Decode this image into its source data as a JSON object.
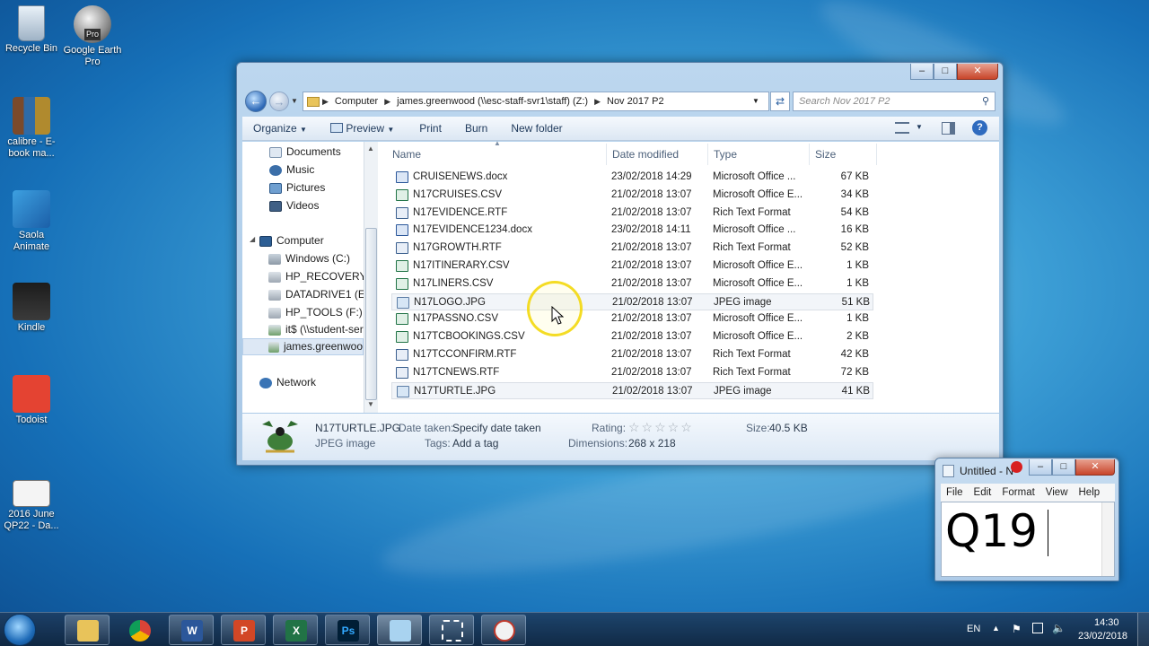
{
  "desktop": {
    "icons": [
      {
        "label": "Recycle Bin"
      },
      {
        "label": "Google Earth Pro",
        "badge": "Pro"
      },
      {
        "label": "calibre - E-book ma..."
      },
      {
        "label": "Saola Animate"
      },
      {
        "label": "Kindle"
      },
      {
        "label": "Todoist"
      },
      {
        "label": "2016 June QP22 - Da..."
      }
    ]
  },
  "explorer": {
    "address": {
      "segments": [
        "Computer",
        "james.greenwood (\\\\esc-staff-svr1\\staff) (Z:)",
        "Nov 2017 P2"
      ]
    },
    "search_placeholder": "Search Nov 2017 P2",
    "toolbar": {
      "organize": "Organize",
      "preview": "Preview",
      "print": "Print",
      "burn": "Burn",
      "new_folder": "New folder"
    },
    "nav": {
      "libraries": [
        "Documents",
        "Music",
        "Pictures",
        "Videos"
      ],
      "computer": "Computer",
      "drives": [
        "Windows (C:)",
        "HP_RECOVERY (D:",
        "DATADRIVE1 (E:)",
        "HP_TOOLS (F:)",
        "it$ (\\\\student-ser",
        "james.greenwoo"
      ],
      "network": "Network"
    },
    "columns": {
      "name": "Name",
      "date": "Date modified",
      "type": "Type",
      "size": "Size"
    },
    "files": [
      {
        "name": "CRUISENEWS.docx",
        "date": "23/02/2018 14:29",
        "type": "Microsoft Office ...",
        "size": "67 KB",
        "icon": "word-doc-icon"
      },
      {
        "name": "N17CRUISES.CSV",
        "date": "21/02/2018 13:07",
        "type": "Microsoft Office E...",
        "size": "34 KB",
        "icon": "excel-csv-icon"
      },
      {
        "name": "N17EVIDENCE.RTF",
        "date": "21/02/2018 13:07",
        "type": "Rich Text Format",
        "size": "54 KB",
        "icon": "rtf-icon"
      },
      {
        "name": "N17EVIDENCE1234.docx",
        "date": "23/02/2018 14:11",
        "type": "Microsoft Office ...",
        "size": "16 KB",
        "icon": "word-doc-icon"
      },
      {
        "name": "N17GROWTH.RTF",
        "date": "21/02/2018 13:07",
        "type": "Rich Text Format",
        "size": "52 KB",
        "icon": "rtf-icon"
      },
      {
        "name": "N17ITINERARY.CSV",
        "date": "21/02/2018 13:07",
        "type": "Microsoft Office E...",
        "size": "1 KB",
        "icon": "excel-csv-icon"
      },
      {
        "name": "N17LINERS.CSV",
        "date": "21/02/2018 13:07",
        "type": "Microsoft Office E...",
        "size": "1 KB",
        "icon": "excel-csv-icon"
      },
      {
        "name": "N17LOGO.JPG",
        "date": "21/02/2018 13:07",
        "type": "JPEG image",
        "size": "51 KB",
        "icon": "jpeg-icon"
      },
      {
        "name": "N17PASSNO.CSV",
        "date": "21/02/2018 13:07",
        "type": "Microsoft Office E...",
        "size": "1 KB",
        "icon": "excel-csv-icon"
      },
      {
        "name": "N17TCBOOKINGS.CSV",
        "date": "21/02/2018 13:07",
        "type": "Microsoft Office E...",
        "size": "2 KB",
        "icon": "excel-csv-icon"
      },
      {
        "name": "N17TCCONFIRM.RTF",
        "date": "21/02/2018 13:07",
        "type": "Rich Text Format",
        "size": "42 KB",
        "icon": "rtf-icon"
      },
      {
        "name": "N17TCNEWS.RTF",
        "date": "21/02/2018 13:07",
        "type": "Rich Text Format",
        "size": "72 KB",
        "icon": "rtf-icon"
      },
      {
        "name": "N17TURTLE.JPG",
        "date": "21/02/2018 13:07",
        "type": "JPEG image",
        "size": "41 KB",
        "icon": "jpeg-icon"
      }
    ],
    "details": {
      "filename": "N17TURTLE.JPG",
      "filetype": "JPEG image",
      "date_taken_label": "Date taken:",
      "date_taken_value": "Specify date taken",
      "tags_label": "Tags:",
      "tags_value": "Add a tag",
      "rating_label": "Rating:",
      "rating_value": 0,
      "dimensions_label": "Dimensions:",
      "dimensions_value": "268 x 218",
      "size_label": "Size:",
      "size_value": "40.5 KB"
    }
  },
  "notepad": {
    "title": "Untitled - N",
    "menu": [
      "File",
      "Edit",
      "Format",
      "View",
      "Help"
    ],
    "text": "Q19"
  },
  "taskbar": {
    "language": "EN",
    "time": "14:30",
    "date": "23/02/2018",
    "apps": [
      "explorer",
      "chrome",
      "word",
      "powerpoint",
      "excel",
      "photoshop",
      "notepad",
      "snipping-tool",
      "paint"
    ]
  }
}
